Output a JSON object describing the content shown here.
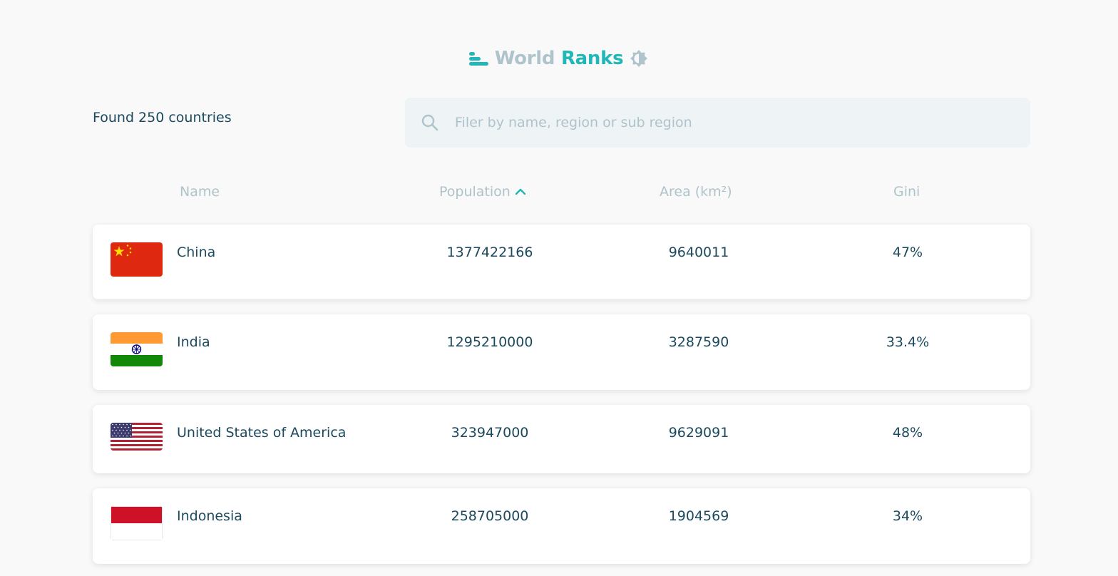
{
  "header": {
    "title_part1": "World",
    "title_part2": "Ranks",
    "logo_icon": "bars-icon",
    "theme_icon": "brightness-icon"
  },
  "summary": {
    "count_text": "Found 250 countries"
  },
  "search": {
    "icon": "search-icon",
    "placeholder": "Filer by name, region or sub region",
    "value": ""
  },
  "table": {
    "columns": [
      {
        "label": "Name"
      },
      {
        "label": "Population",
        "sort": "ascending-chevron-up"
      },
      {
        "label": "Area (km²)"
      },
      {
        "label": "Gini"
      }
    ],
    "rows": [
      {
        "flag": "china-flag",
        "name": "China",
        "population": "1377422166",
        "area": "9640011",
        "gini": "47%"
      },
      {
        "flag": "india-flag",
        "name": "India",
        "population": "1295210000",
        "area": "3287590",
        "gini": "33.4%"
      },
      {
        "flag": "usa-flag",
        "name": "United States of America",
        "population": "323947000",
        "area": "9629091",
        "gini": "48%"
      },
      {
        "flag": "indonesia-flag",
        "name": "Indonesia",
        "population": "258705000",
        "area": "1904569",
        "gini": "34%"
      }
    ]
  },
  "colors": {
    "accent": "#21b6b7",
    "muted": "#afc3cb",
    "text": "#1b4a5e",
    "background": "#f9f9f9"
  }
}
